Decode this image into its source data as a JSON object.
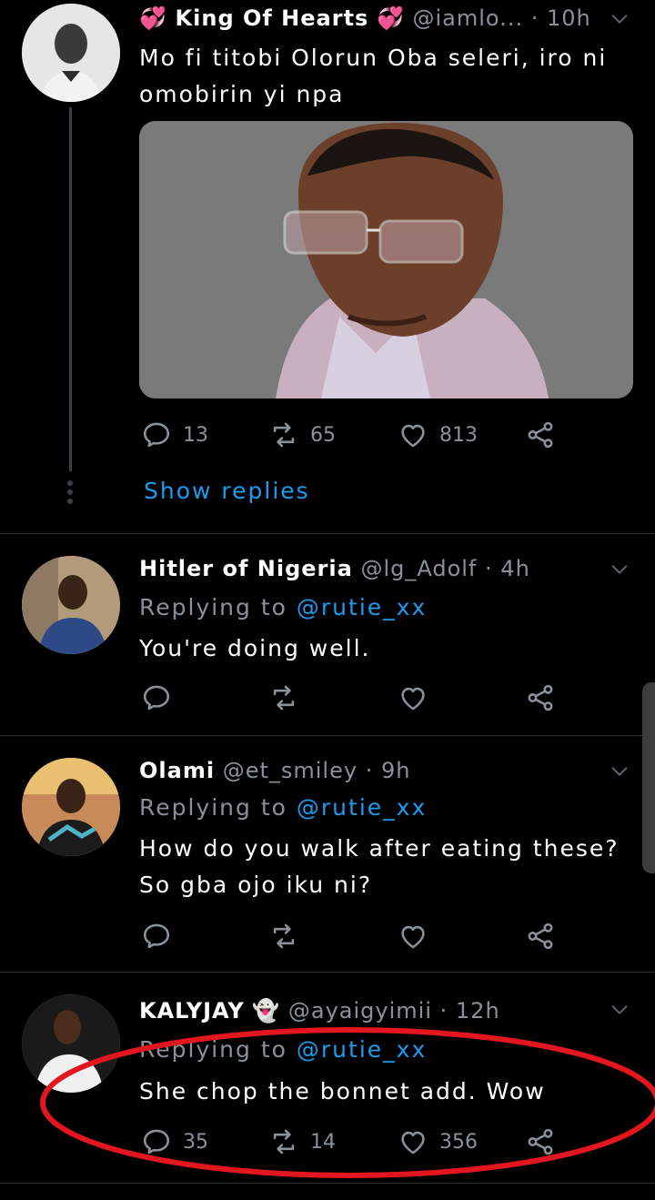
{
  "colors": {
    "background": "#000000",
    "muted": "#8a9299",
    "accent": "#1d9bf0",
    "annotation": "#e3151e"
  },
  "tweets": [
    {
      "name_prefix_emoji": "💞",
      "name": "King Of Hearts",
      "name_suffix_emoji": "💞",
      "handle": "@iamlo...",
      "time": "10h",
      "text": "Mo fi titobi Olorun Oba seleri, iro ni omobirin yi npa",
      "replies": "13",
      "retweets": "65",
      "likes": "813",
      "show_replies": "Show replies"
    },
    {
      "name": "Hitler of Nigeria",
      "handle": "@lg_Adolf",
      "time": "4h",
      "replying_prefix": "Replying to",
      "replying_to": "@rutie_xx",
      "text": "You're doing well.",
      "replies": "",
      "retweets": "",
      "likes": ""
    },
    {
      "name": "Olami",
      "handle": "@et_smiley",
      "time": "9h",
      "replying_prefix": "Replying to",
      "replying_to": "@rutie_xx",
      "text": "How do you walk after eating these? So gba ojo iku ni?",
      "replies": "",
      "retweets": "",
      "likes": ""
    },
    {
      "name": "KALYJAY",
      "name_suffix_emoji": "👻",
      "handle": "@ayaigyimii",
      "time": "12h",
      "replying_prefix": "Replying to",
      "replying_to": "@rutie_xx",
      "text": "She chop the bonnet add. Wow",
      "replies": "35",
      "retweets": "14",
      "likes": "356"
    }
  ],
  "separator": "·"
}
